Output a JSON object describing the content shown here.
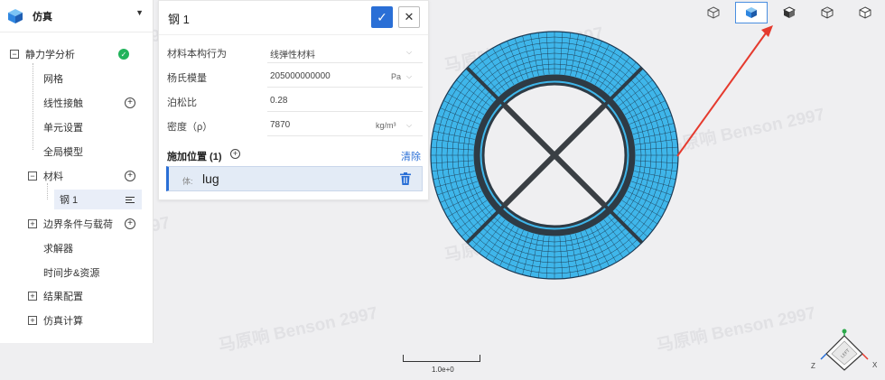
{
  "tree": {
    "title": "仿真",
    "items": [
      {
        "label": "静力学分析",
        "status": "ok"
      },
      {
        "label": "网格"
      },
      {
        "label": "线性接触"
      },
      {
        "label": "单元设置"
      },
      {
        "label": "全局模型"
      },
      {
        "label": "材料"
      },
      {
        "label": "钢 1"
      },
      {
        "label": "边界条件与载荷"
      },
      {
        "label": "求解器"
      },
      {
        "label": "时间步&资源"
      },
      {
        "label": "结果配置"
      },
      {
        "label": "仿真计算"
      }
    ]
  },
  "panel": {
    "title": "钢 1",
    "fields": [
      {
        "label": "材料本构行为",
        "value": "线弹性材料",
        "unit": ""
      },
      {
        "label": "杨氏模量",
        "value": "205000000000",
        "unit": "Pa"
      },
      {
        "label": "泊松比",
        "value": "0.28",
        "unit": ""
      },
      {
        "label": "密度（ρ）",
        "value": "7870",
        "unit": "kg/m³"
      }
    ],
    "apply": {
      "label": "施加位置 (1)",
      "clear": "清除",
      "item_tag": "体:",
      "item_value": "lug"
    }
  },
  "viewport": {
    "scale_label": "1.0e+0",
    "axis_z": "Z",
    "axis_x": "X",
    "watermark": "马原响 Benson 2997",
    "mesh_color": "#3fb6ea",
    "arrow_color": "#e53a2e"
  },
  "colors": {
    "accent": "#2a6fd6",
    "ok": "#21b35b"
  }
}
